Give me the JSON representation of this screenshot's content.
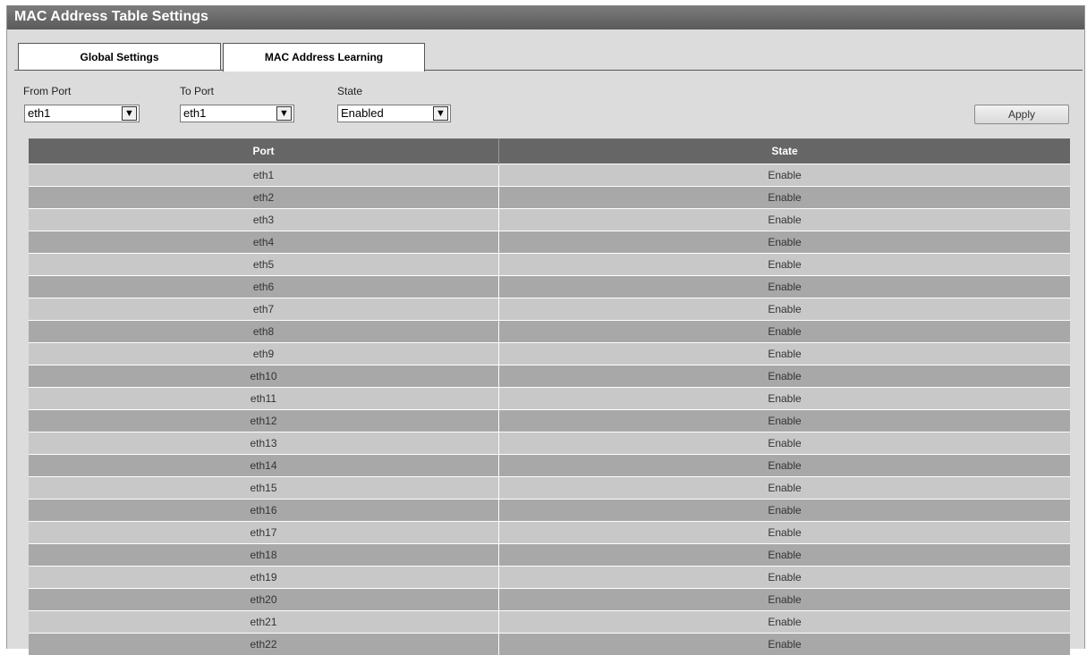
{
  "title": "MAC Address Table Settings",
  "tabs": [
    {
      "label": "Global Settings",
      "active": false
    },
    {
      "label": "MAC Address Learning",
      "active": true
    }
  ],
  "form": {
    "from_port": {
      "label": "From Port",
      "value": "eth1"
    },
    "to_port": {
      "label": "To Port",
      "value": "eth1"
    },
    "state": {
      "label": "State",
      "value": "Enabled"
    },
    "apply_label": "Apply"
  },
  "table": {
    "headers": [
      "Port",
      "State"
    ],
    "rows": [
      {
        "port": "eth1",
        "state": "Enable"
      },
      {
        "port": "eth2",
        "state": "Enable"
      },
      {
        "port": "eth3",
        "state": "Enable"
      },
      {
        "port": "eth4",
        "state": "Enable"
      },
      {
        "port": "eth5",
        "state": "Enable"
      },
      {
        "port": "eth6",
        "state": "Enable"
      },
      {
        "port": "eth7",
        "state": "Enable"
      },
      {
        "port": "eth8",
        "state": "Enable"
      },
      {
        "port": "eth9",
        "state": "Enable"
      },
      {
        "port": "eth10",
        "state": "Enable"
      },
      {
        "port": "eth11",
        "state": "Enable"
      },
      {
        "port": "eth12",
        "state": "Enable"
      },
      {
        "port": "eth13",
        "state": "Enable"
      },
      {
        "port": "eth14",
        "state": "Enable"
      },
      {
        "port": "eth15",
        "state": "Enable"
      },
      {
        "port": "eth16",
        "state": "Enable"
      },
      {
        "port": "eth17",
        "state": "Enable"
      },
      {
        "port": "eth18",
        "state": "Enable"
      },
      {
        "port": "eth19",
        "state": "Enable"
      },
      {
        "port": "eth20",
        "state": "Enable"
      },
      {
        "port": "eth21",
        "state": "Enable"
      },
      {
        "port": "eth22",
        "state": "Enable"
      }
    ]
  }
}
